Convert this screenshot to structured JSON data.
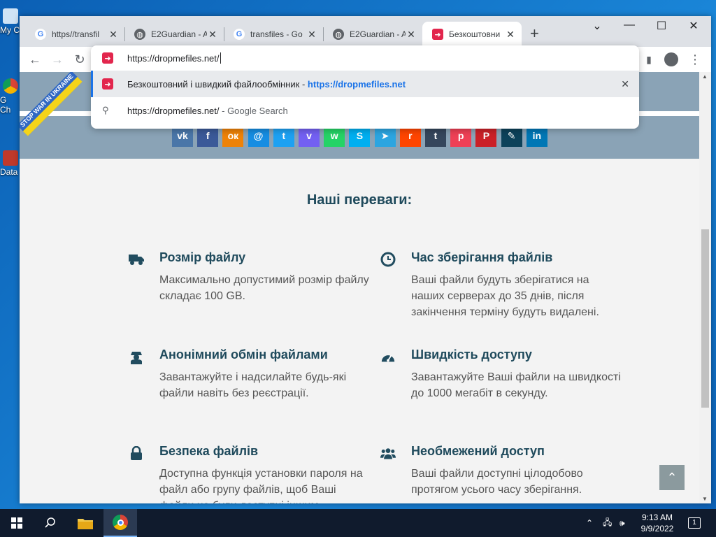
{
  "desktop": {
    "icons": [
      {
        "label": "My C"
      },
      {
        "label": "G\nCh"
      },
      {
        "label": "Data"
      }
    ]
  },
  "browser": {
    "tabs": [
      {
        "title": "https//transfil",
        "favicon": "google-icon",
        "active": false
      },
      {
        "title": "E2Guardian - A",
        "favicon": "globe-icon",
        "active": false
      },
      {
        "title": "transfiles - Go",
        "favicon": "google-icon",
        "active": false
      },
      {
        "title": "E2Guardian - A",
        "favicon": "globe-icon",
        "active": false
      },
      {
        "title": "Безкоштовни",
        "favicon": "dropmefiles-icon",
        "active": true
      }
    ],
    "address": "https://dropmefiles.net/",
    "suggestions": [
      {
        "text": "Безкоштовний і швидкий файлообмінник - ",
        "url": "https://dropmefiles.net"
      },
      {
        "text": "https://dropmefiles.net/",
        "suffix": " - Google Search"
      }
    ]
  },
  "page": {
    "badge": "STOP WAR IN UKRAINE",
    "section_title": "Наші переваги:",
    "features": [
      {
        "title": "Розмір файлу",
        "text": "Максимально допустимий розмір файлу складає 100 GB.",
        "icon": "truck-icon"
      },
      {
        "title": "Час зберігання файлів",
        "text": "Ваші файли будуть зберігатися на наших серверах до 35 днів, після закінчення терміну будуть видалені.",
        "icon": "clock-icon"
      },
      {
        "title": "Анонімний обмін файлами",
        "text": "Завантажуйте і надсилайте будь-які файли навіть без реєстрації.",
        "icon": "spy-icon"
      },
      {
        "title": "Швидкість доступу",
        "text": "Завантажуйте Ваші файли на швидкості до 1000 мегабіт в секунду.",
        "icon": "speedometer-icon"
      },
      {
        "title": "Безпека файлів",
        "text": "Доступна функція установки пароля на файл або групу файлів, щоб Ваші файли не були доступні іншим",
        "icon": "lock-icon"
      },
      {
        "title": "Необмежений доступ",
        "text": "Ваші файли доступні цілодобово протягом усього часу зберігання.",
        "icon": "users-icon"
      }
    ],
    "social": [
      {
        "name": "vk-icon",
        "glyph": "vk",
        "color": "#4a76a8"
      },
      {
        "name": "facebook-icon",
        "glyph": "f",
        "color": "#3b5998"
      },
      {
        "name": "odnoklassniki-icon",
        "glyph": "ок",
        "color": "#ee8208"
      },
      {
        "name": "moimir-icon",
        "glyph": "@",
        "color": "#168de2"
      },
      {
        "name": "twitter-icon",
        "glyph": "t",
        "color": "#1da1f2"
      },
      {
        "name": "viber-icon",
        "glyph": "v",
        "color": "#7360f2"
      },
      {
        "name": "whatsapp-icon",
        "glyph": "w",
        "color": "#25d366"
      },
      {
        "name": "skype-icon",
        "glyph": "S",
        "color": "#00aff0"
      },
      {
        "name": "telegram-icon",
        "glyph": "➤",
        "color": "#2ca5e0"
      },
      {
        "name": "reddit-icon",
        "glyph": "r",
        "color": "#ff4500"
      },
      {
        "name": "tumblr-icon",
        "glyph": "t",
        "color": "#35465c"
      },
      {
        "name": "pocket-icon",
        "glyph": "p",
        "color": "#ef4056"
      },
      {
        "name": "pinterest-icon",
        "glyph": "P",
        "color": "#cb2027"
      },
      {
        "name": "livejournal-icon",
        "glyph": "✎",
        "color": "#0d425a"
      },
      {
        "name": "linkedin-icon",
        "glyph": "in",
        "color": "#0077b5"
      }
    ]
  },
  "taskbar": {
    "time": "9:13 AM",
    "date": "9/9/2022",
    "notifications": "1"
  }
}
